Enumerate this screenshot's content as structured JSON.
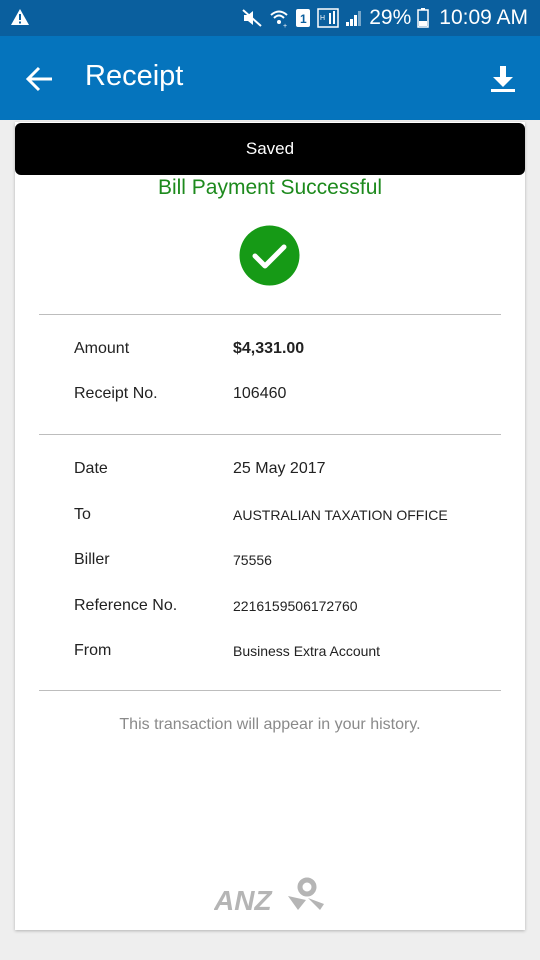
{
  "status_bar": {
    "battery_pct": "29%",
    "time": "10:09 AM"
  },
  "header": {
    "title": "Receipt"
  },
  "toast": {
    "text": "Saved"
  },
  "receipt": {
    "headline": "Bill Payment Successful",
    "summary": [
      {
        "label": "Amount",
        "value": "$4,331.00"
      },
      {
        "label": "Receipt No.",
        "value": "106460"
      }
    ],
    "details": [
      {
        "label": "Date",
        "value": "25 May 2017"
      },
      {
        "label": "To",
        "value": "AUSTRALIAN TAXATION OFFICE"
      },
      {
        "label": "Biller",
        "value": "75556"
      },
      {
        "label": "Reference No.",
        "value": "2216159506172760"
      },
      {
        "label": "From",
        "value": "Business Extra Account"
      }
    ],
    "note": "This transaction will appear in your history."
  },
  "brand": {
    "logo_text": "ANZ",
    "color": "#0574bd",
    "success_color": "#1d8a1d"
  }
}
